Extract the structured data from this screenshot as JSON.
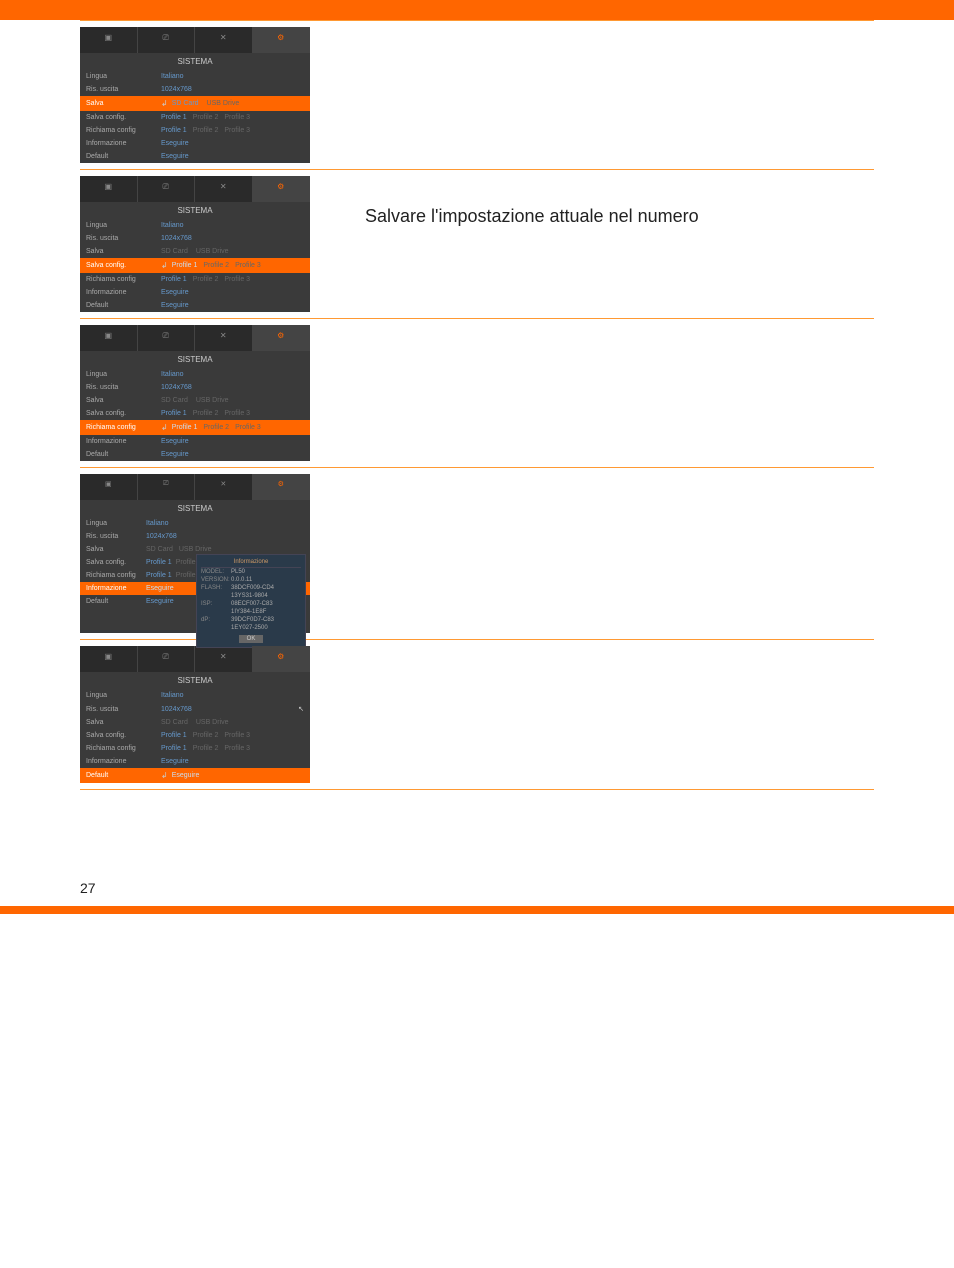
{
  "panel_title": "SISTEMA",
  "rows_labels": {
    "lingua": "Lingua",
    "ris_uscita": "Ris. uscita",
    "salva": "Salva",
    "salva_config": "Salva config.",
    "richiama_config": "Richiama config",
    "informazione": "Informazione",
    "default": "Default"
  },
  "values": {
    "lingua": "Italiano",
    "ris_uscita": "1024x768",
    "sd_card": "SD Card",
    "usb_drive": "USB Drive",
    "profile1": "Profile 1",
    "profile2": "Profile 2",
    "profile3": "Profile 3",
    "eseguire": "Eseguire"
  },
  "description2": "Salvare l'impostazione attuale nel numero",
  "info_popup": {
    "title": "Informazione",
    "model_label": "MODEL:",
    "model_val": "PL50",
    "version_label": "VERSION:",
    "version_val": "0.0.0.11",
    "flash_label": "FLASH:",
    "flash_rows": [
      "38DCF009-CD4",
      "13YS31-9804",
      "08ECF007-C83"
    ],
    "isp_label": "ISP:",
    "dp_label": "dP:",
    "dp_rows": [
      "1IY384-1E8F",
      "39DCF0D7-C83",
      "1EY027-2500"
    ],
    "ok": "OK"
  },
  "page_num": "27"
}
